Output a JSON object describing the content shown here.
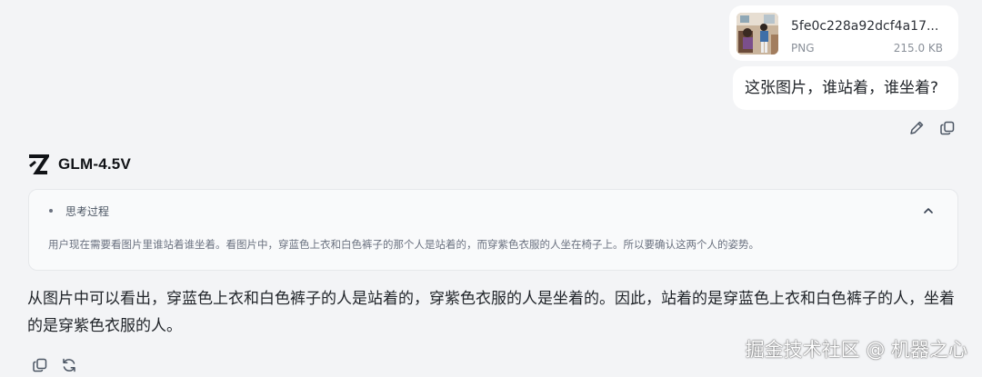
{
  "attachment": {
    "file_name": "5fe0c228a92dcf4a17...",
    "file_type": "PNG",
    "file_size": "215.0 KB",
    "thumbnail_icon": "photo-thumbnail"
  },
  "user_message": {
    "text": "这张图片，谁站着，谁坐着?"
  },
  "user_actions": {
    "edit_icon": "pencil-icon",
    "copy_icon": "copy-icon"
  },
  "model": {
    "name": "GLM-4.5V",
    "logo_icon": "z-logo-icon"
  },
  "thinking": {
    "title": "思考过程",
    "text": "用户现在需要看图片里谁站着谁坐着。看图片中，穿蓝色上衣和白色裤子的那个人是站着的，而穿紫色衣服的人坐在椅子上。所以要确认这两个人的姿势。",
    "expanded": true
  },
  "answer": {
    "text": "从图片中可以看出，穿蓝色上衣和白色裤子的人是站着的，穿紫色衣服的人是坐着的。因此，站着的是穿蓝色上衣和白色裤子的人，坐着的是穿紫色衣服的人。"
  },
  "answer_actions": {
    "copy_icon": "copy-icon",
    "regenerate_icon": "refresh-icon"
  },
  "watermark": {
    "text": "掘金技术社区 @ 机器之心"
  },
  "colors": {
    "background": "#f3f4f6",
    "bubble": "#ffffff",
    "panel": "#f9fafb",
    "text": "#1f2328",
    "muted": "#6b7280"
  }
}
